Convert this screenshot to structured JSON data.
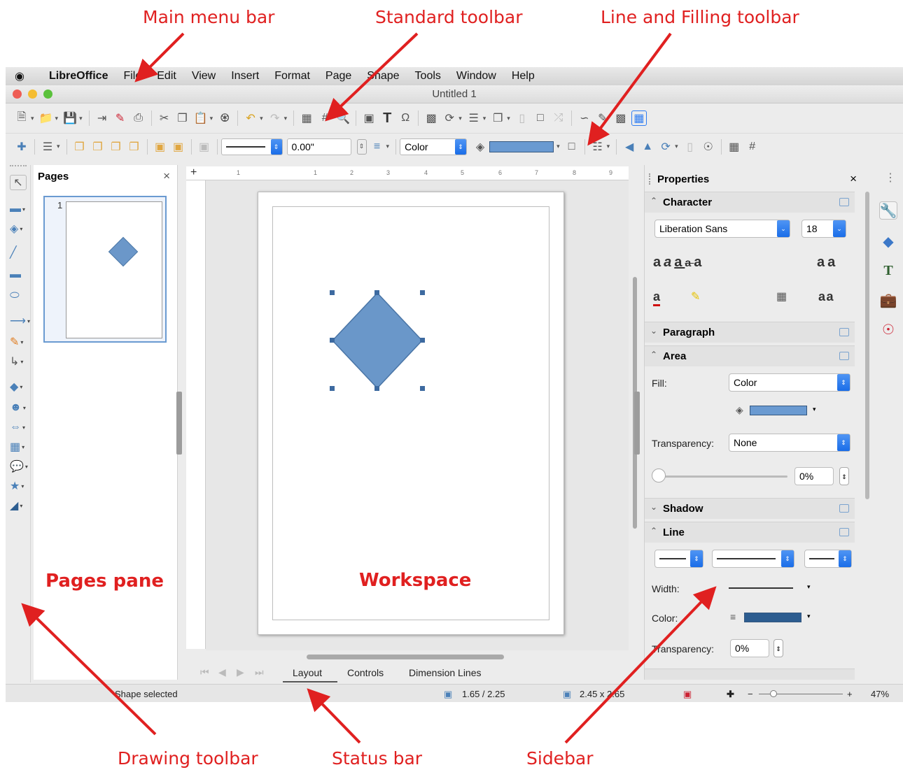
{
  "callouts": {
    "main_menu_bar": "Main menu bar",
    "standard_toolbar": "Standard toolbar",
    "line_filling_toolbar": "Line and Filling toolbar",
    "pages_pane": "Pages pane",
    "workspace": "Workspace",
    "drawing_toolbar": "Drawing toolbar",
    "status_bar": "Status bar",
    "sidebar": "Sidebar"
  },
  "menubar": {
    "app_name": "LibreOffice",
    "items": [
      "File",
      "Edit",
      "View",
      "Insert",
      "Format",
      "Page",
      "Shape",
      "Tools",
      "Window",
      "Help"
    ]
  },
  "window": {
    "title": "Untitled 1"
  },
  "line_toolbar": {
    "line_width": "0.00\"",
    "area_style": "Color"
  },
  "pages_pane": {
    "title": "Pages",
    "close": "×",
    "page_number": "1"
  },
  "ruler": {
    "h_marks": [
      "1",
      "1",
      "2",
      "3",
      "4",
      "5",
      "6",
      "7",
      "8",
      "9"
    ]
  },
  "tabs": {
    "items": [
      "Layout",
      "Controls",
      "Dimension Lines"
    ]
  },
  "status": {
    "selection": "Shape selected",
    "position": "1.65 / 2.25",
    "size": "2.45 x 2.65",
    "zoom": "47%"
  },
  "sidebar": {
    "title": "Properties",
    "close": "×",
    "character": {
      "label": "Character",
      "font": "Liberation Sans",
      "size": "18"
    },
    "paragraph_label": "Paragraph",
    "area": {
      "label": "Area",
      "fill_label": "Fill:",
      "fill_value": "Color",
      "transparency_label": "Transparency:",
      "transparency_value": "None",
      "transparency_percent": "0%"
    },
    "shadow_label": "Shadow",
    "line": {
      "label": "Line",
      "width_label": "Width:",
      "color_label": "Color:",
      "transparency_label": "Transparency:",
      "transparency_value": "0%"
    }
  },
  "colors": {
    "shape_fill": "#6a97c9",
    "callout": "#e02020",
    "accent": "#2f7df2"
  }
}
